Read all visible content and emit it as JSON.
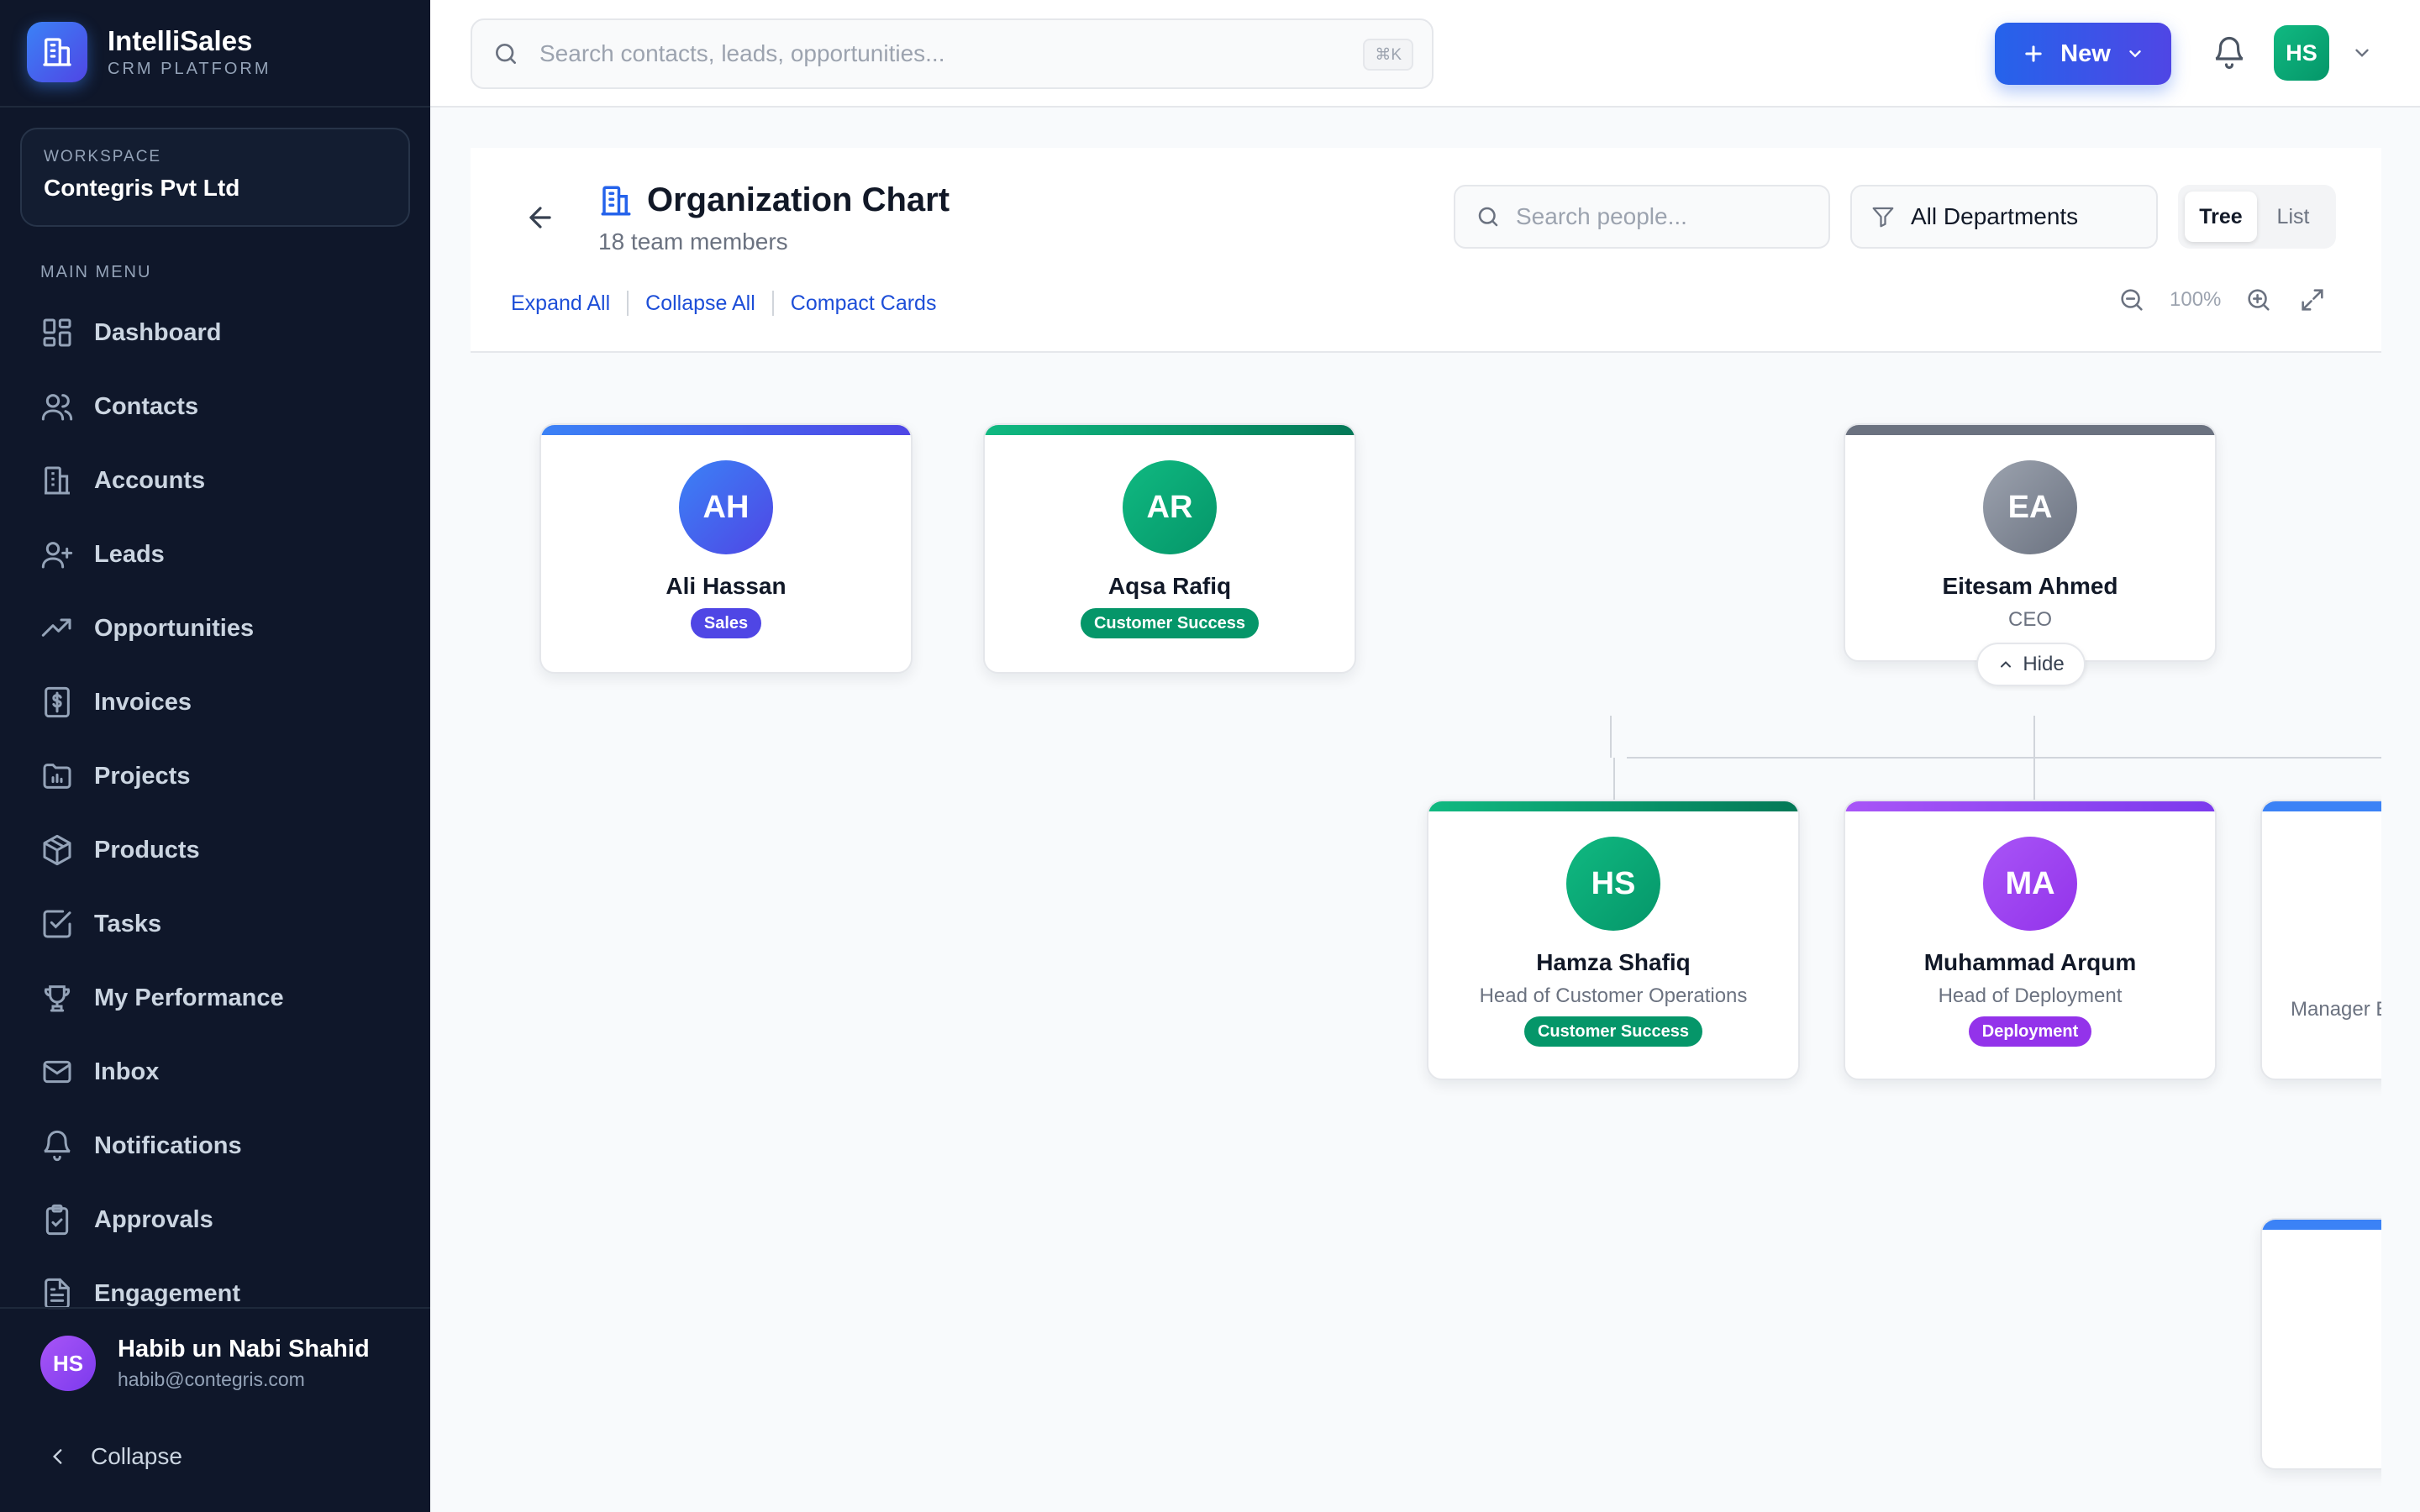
{
  "brand": {
    "name": "IntelliSales",
    "subtitle": "CRM PLATFORM"
  },
  "workspace": {
    "label": "WORKSPACE",
    "name": "Contegris Pvt Ltd"
  },
  "sidebar": {
    "menu_label": "MAIN MENU",
    "items": [
      {
        "label": "Dashboard",
        "icon": "dashboard-icon"
      },
      {
        "label": "Contacts",
        "icon": "users-icon"
      },
      {
        "label": "Accounts",
        "icon": "building-icon"
      },
      {
        "label": "Leads",
        "icon": "user-plus-icon"
      },
      {
        "label": "Opportunities",
        "icon": "trending-up-icon"
      },
      {
        "label": "Invoices",
        "icon": "receipt-dollar-icon"
      },
      {
        "label": "Projects",
        "icon": "folder-chart-icon"
      },
      {
        "label": "Products",
        "icon": "package-icon"
      },
      {
        "label": "Tasks",
        "icon": "checkbox-icon"
      },
      {
        "label": "My Performance",
        "icon": "trophy-icon"
      },
      {
        "label": "Inbox",
        "icon": "mail-icon"
      },
      {
        "label": "Notifications",
        "icon": "bell-icon"
      },
      {
        "label": "Approvals",
        "icon": "clipboard-check-icon"
      },
      {
        "label": "Engagement",
        "icon": "document-icon"
      }
    ],
    "user": {
      "initials": "HS",
      "name": "Habib un Nabi Shahid",
      "email": "habib@contegris.com"
    },
    "collapse_label": "Collapse"
  },
  "topbar": {
    "search_placeholder": "Search contacts, leads, opportunities...",
    "shortcut": "⌘K",
    "new_label": "New",
    "avatar_initials": "HS"
  },
  "page": {
    "title": "Organization Chart",
    "subtitle": "18 team members",
    "links": [
      "Expand All",
      "Collapse All",
      "Compact Cards"
    ],
    "people_search_placeholder": "Search people...",
    "department_filter": "All Departments",
    "view_toggle": [
      "Tree",
      "List"
    ],
    "active_view": "Tree",
    "zoom": "100%",
    "hide_label": "Hide"
  },
  "org": {
    "top_cards": [
      {
        "initials": "AH",
        "name": "Ali Hassan",
        "title": "",
        "badge": "Sales",
        "color": "#4f46e5"
      },
      {
        "initials": "AR",
        "name": "Aqsa Rafiq",
        "title": "",
        "badge": "Customer Success",
        "color": "#059669"
      },
      {
        "initials": "EA",
        "name": "Eitesam Ahmed",
        "title": "CEO",
        "badge": "",
        "color": "#6b7280"
      }
    ],
    "children": [
      {
        "initials": "HS",
        "name": "Hamza Shafiq",
        "title": "Head of Customer Operations",
        "badge": "Customer Success",
        "color": "#059669"
      },
      {
        "initials": "MA",
        "name": "Muhammad Arqum",
        "title": "Head of Deployment",
        "badge": "Deployment",
        "color": "#9333ea"
      },
      {
        "initials": "",
        "name": "",
        "title": "Manager E",
        "badge": "",
        "color": "#3b82f6"
      }
    ]
  }
}
